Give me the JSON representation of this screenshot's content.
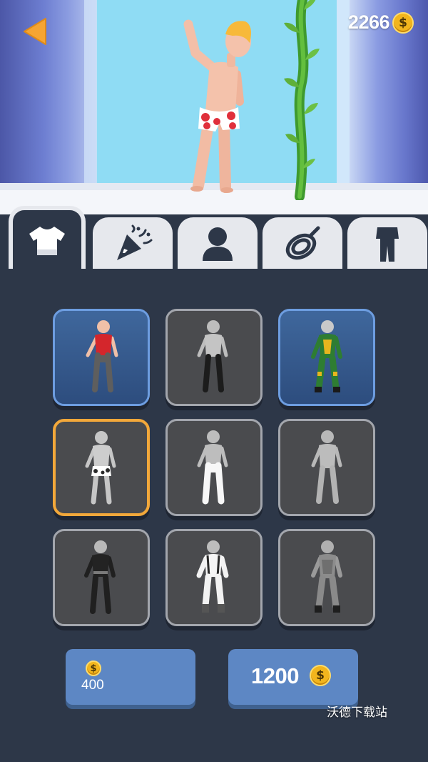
{
  "hud": {
    "coin_balance": "2266",
    "coin_icon": "$"
  },
  "tabs": [
    {
      "name": "outfits",
      "icon": "shirt-icon",
      "active": true
    },
    {
      "name": "effects",
      "icon": "party-popper-icon",
      "active": false
    },
    {
      "name": "character",
      "icon": "person-silhouette-icon",
      "active": false
    },
    {
      "name": "ropes",
      "icon": "rope-coil-icon",
      "active": false
    },
    {
      "name": "suits",
      "icon": "suit-icon",
      "active": false
    }
  ],
  "outfits": [
    {
      "id": "red-shirt",
      "state": "owned"
    },
    {
      "id": "grey-black",
      "state": "locked"
    },
    {
      "id": "green-hero",
      "state": "owned"
    },
    {
      "id": "boxers",
      "state": "selected"
    },
    {
      "id": "white-pants",
      "state": "locked"
    },
    {
      "id": "plain-grey",
      "state": "locked"
    },
    {
      "id": "black-ninja",
      "state": "locked"
    },
    {
      "id": "white-suspenders",
      "state": "locked"
    },
    {
      "id": "grey-armor",
      "state": "locked"
    }
  ],
  "buttons": {
    "random_price": "400",
    "buy_price": "1200",
    "coin_symbol": "$"
  },
  "watermark": "沃德下载站",
  "colors": {
    "panel": "#2d3748",
    "owned_border": "#6d9de0",
    "selected_border": "#f3a83a",
    "button": "#5d87c4",
    "coin": "#f2b51d"
  }
}
